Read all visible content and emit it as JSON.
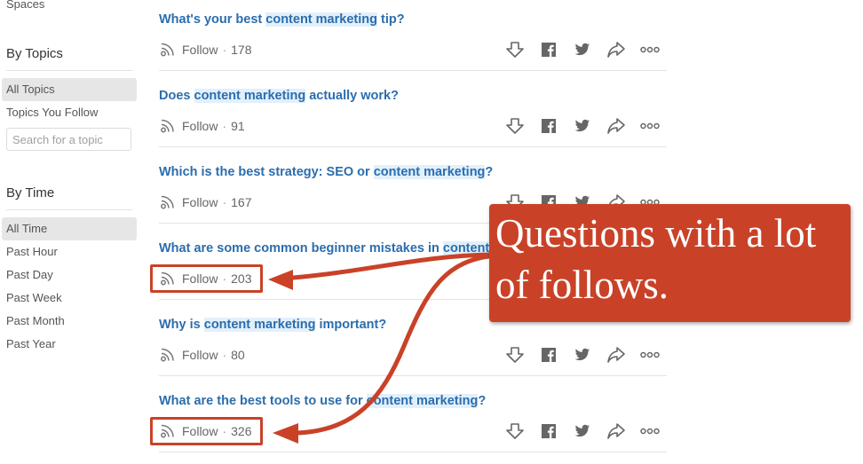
{
  "sidebar": {
    "spaces_label": "Spaces",
    "by_topics": {
      "heading": "By Topics",
      "items": [
        {
          "label": "All Topics",
          "active": true
        },
        {
          "label": "Topics You Follow",
          "active": false
        }
      ],
      "search_placeholder": "Search for a topic"
    },
    "by_time": {
      "heading": "By Time",
      "items": [
        {
          "label": "All Time",
          "active": true
        },
        {
          "label": "Past Hour",
          "active": false
        },
        {
          "label": "Past Day",
          "active": false
        },
        {
          "label": "Past Week",
          "active": false
        },
        {
          "label": "Past Month",
          "active": false
        },
        {
          "label": "Past Year",
          "active": false
        }
      ]
    }
  },
  "questions": [
    {
      "pre": "What's your best ",
      "highlight": "content marketing",
      "post": " tip?",
      "follow_label": "Follow",
      "sep": "·",
      "follow_count": "178"
    },
    {
      "pre": "Does ",
      "highlight": "content marketing",
      "post": " actually work?",
      "follow_label": "Follow",
      "sep": "·",
      "follow_count": "91"
    },
    {
      "pre": "Which is the best strategy: SEO or ",
      "highlight": "content marketing",
      "post": "?",
      "follow_label": "Follow",
      "sep": "·",
      "follow_count": "167"
    },
    {
      "pre": "What are some common beginner mistakes in ",
      "highlight": "content marketing",
      "post": "?",
      "follow_label": "Follow",
      "sep": "·",
      "follow_count": "203"
    },
    {
      "pre": "Why is ",
      "highlight": "content marketing",
      "post": " important?",
      "follow_label": "Follow",
      "sep": "·",
      "follow_count": "80"
    },
    {
      "pre": "What are the best tools to use for ",
      "highlight": "content marketing",
      "post": "?",
      "follow_label": "Follow",
      "sep": "·",
      "follow_count": "326"
    }
  ],
  "actions": [
    {
      "icon": "downvote-icon"
    },
    {
      "icon": "facebook-icon"
    },
    {
      "icon": "twitter-icon"
    },
    {
      "icon": "share-icon"
    },
    {
      "icon": "more-icon"
    }
  ],
  "annotation": {
    "callout_line1": "Questions with a lot",
    "callout_line2": "of follows.",
    "color": "#c94228"
  },
  "colors": {
    "link": "#2b6dad",
    "highlight_bg": "#e2f0fb",
    "annotation": "#c94228"
  }
}
